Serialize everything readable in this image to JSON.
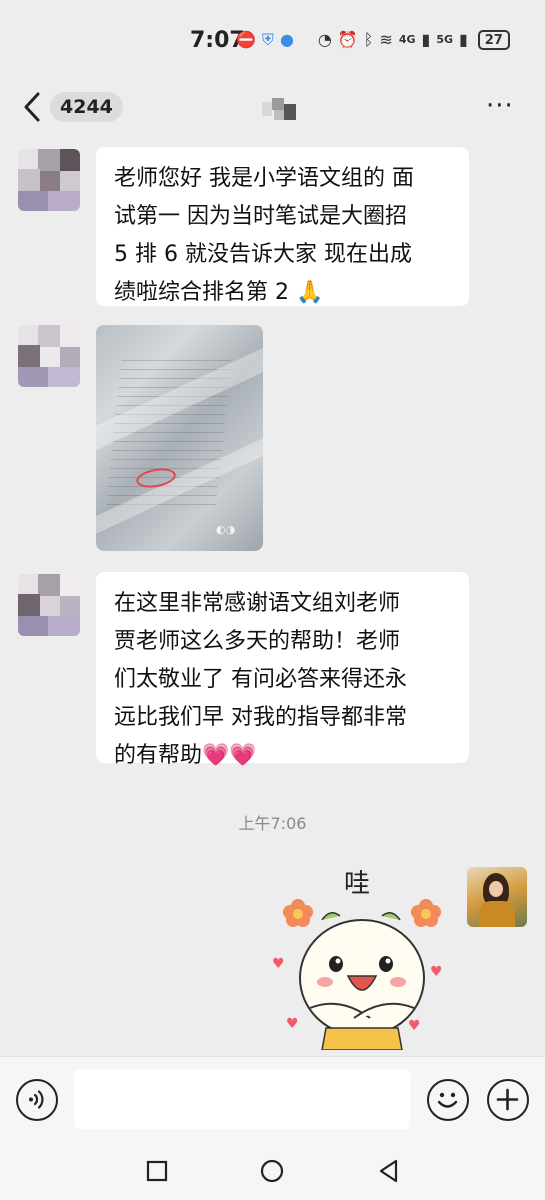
{
  "status_bar": {
    "time": "7:07",
    "signal_1": "4G",
    "signal_2": "5G",
    "battery": "27"
  },
  "nav": {
    "unread_count": "4244",
    "more": "···"
  },
  "messages": [
    {
      "sender": "other",
      "type": "text",
      "lines": [
        "老师您好 我是小学语文组的 面",
        "试第一 因为当时笔试是大圈招",
        "5 排 6 就没告诉大家 现在出成",
        "绩啦综合排名第 2 "
      ],
      "emoji": "🙏"
    },
    {
      "sender": "other",
      "type": "image"
    },
    {
      "sender": "other",
      "type": "text",
      "lines": [
        "在这里非常感谢语文组刘老师",
        "贾老师这么多天的帮助！老师",
        "们太敬业了 有问必答来得还永",
        "远比我们早 对我的指导都非常",
        "的有帮助"
      ],
      "emoji": "💗💗"
    }
  ],
  "timestamp": "上午7:06",
  "sticker": {
    "text": "哇"
  },
  "input": {
    "placeholder": ""
  },
  "colors": {
    "background": "#ededed",
    "bubble": "#ffffff",
    "accent_red": "#e04848",
    "text": "#111111"
  }
}
